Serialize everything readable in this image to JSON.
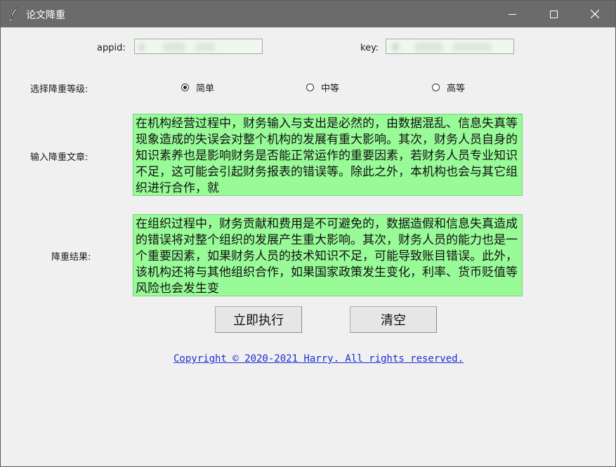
{
  "window": {
    "title": "论文降重",
    "controls": {
      "minimize": "minimize-icon",
      "maximize": "maximize-icon",
      "close": "close-icon"
    }
  },
  "credentials": {
    "appid_label": "appid:",
    "key_label": "key:"
  },
  "level": {
    "label": "选择降重等级:",
    "options": [
      {
        "label": "简单",
        "selected": true
      },
      {
        "label": "中等",
        "selected": false
      },
      {
        "label": "高等",
        "selected": false
      }
    ]
  },
  "input": {
    "label": "输入降重文章:",
    "text": "在机构经营过程中，财务输入与支出是必然的，由数据混乱、信息失真等现象造成的失误会对整个机构的发展有重大影响。其次，财务人员自身的知识素养也是影响财务是否能正常运作的重要因素，若财务人员专业知识不足，这可能会引起财务报表的错误等。除此之外，本机构也会与其它组织进行合作，就"
  },
  "result": {
    "label": "降重结果:",
    "text": "在组织过程中，财务贡献和费用是不可避免的，数据造假和信息失真造成的错误将对整个组织的发展产生重大影响。其次，财务人员的能力也是一个重要因素，如果财务人员的技术知识不足，可能导致账目错误。此外，该机构还将与其他组织合作，如果国家政策发生变化，利率、货币贬值等风险也会发生变"
  },
  "buttons": {
    "execute": "立即执行",
    "clear": "清空"
  },
  "footer": {
    "copyright": "Copyright © 2020-2021 Harry. All rights reserved."
  },
  "colors": {
    "textbox_bg": "#98fb98",
    "titlebar": "#6b6b6b",
    "link": "#1a2ed4"
  }
}
